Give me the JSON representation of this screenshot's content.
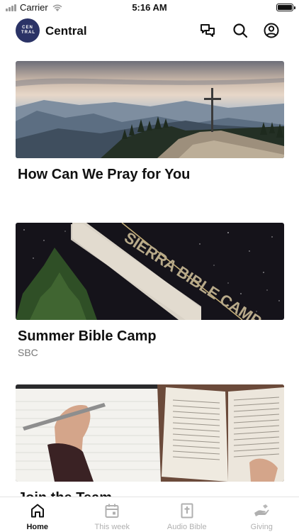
{
  "status_bar": {
    "carrier": "Carrier",
    "time": "5:16 AM"
  },
  "header": {
    "logo_text": "CEN TRAL",
    "title": "Central"
  },
  "feed": [
    {
      "title": "How Can We Pray for You",
      "subtitle": ""
    },
    {
      "title": "Summer Bible Camp",
      "subtitle": "SBC",
      "image_sign_text": "SIERRA BIBLE CAMP"
    },
    {
      "title": "Join the Team",
      "subtitle": ""
    }
  ],
  "tabs": [
    {
      "label": "Home",
      "icon": "home-icon",
      "active": true
    },
    {
      "label": "This week",
      "icon": "calendar-icon",
      "active": false
    },
    {
      "label": "Audio Bible",
      "icon": "bible-icon",
      "active": false
    },
    {
      "label": "Giving",
      "icon": "giving-hand-icon",
      "active": false
    }
  ],
  "colors": {
    "brand": "#2b3366",
    "active_tab": "#111111",
    "inactive_tab": "#b0b0b0"
  }
}
